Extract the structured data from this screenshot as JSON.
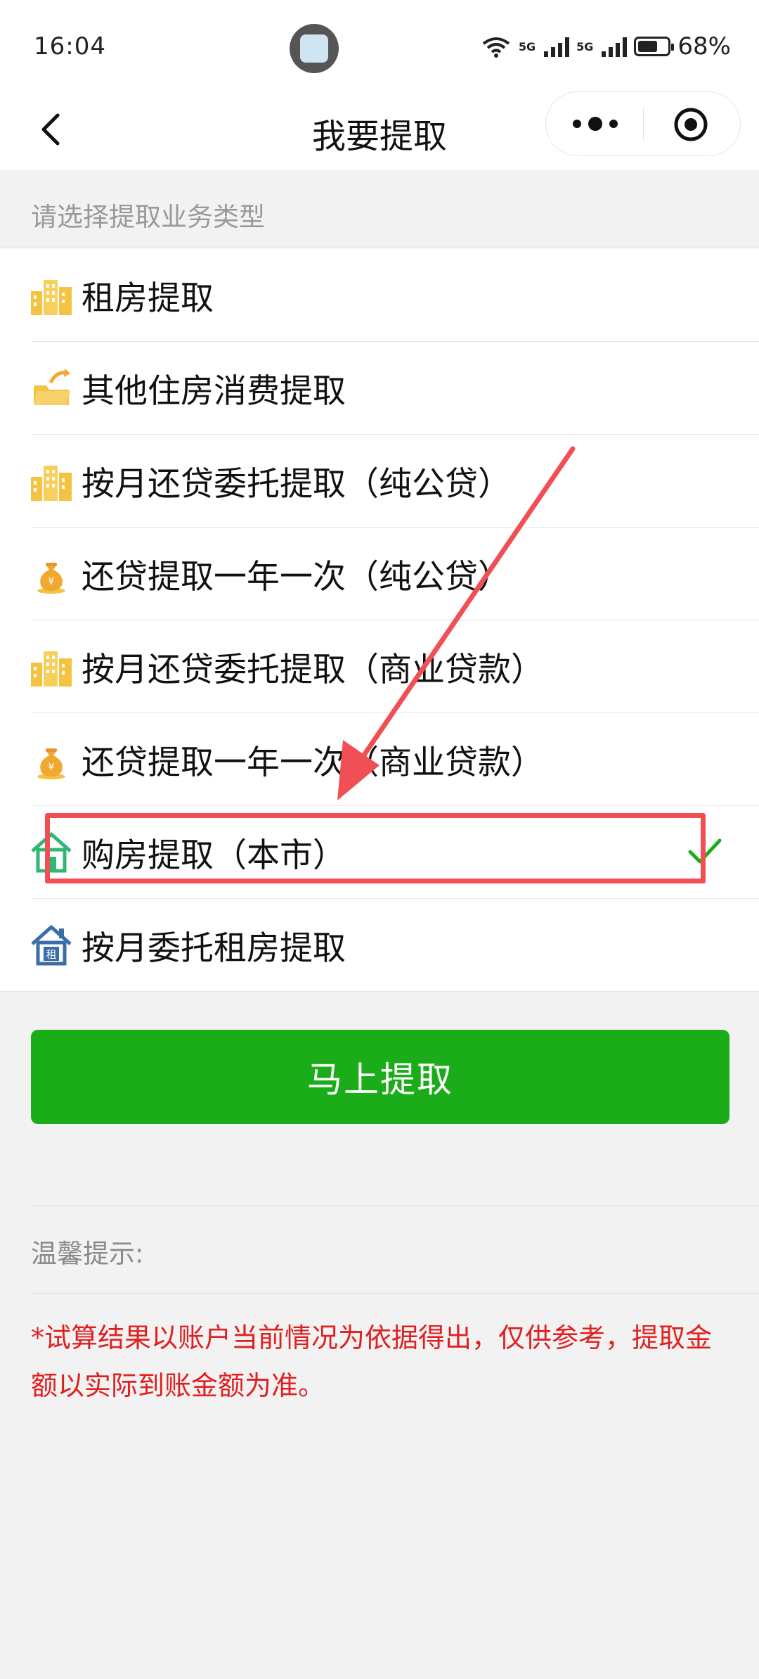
{
  "status_bar": {
    "time": "16:04",
    "network_1": "5G",
    "network_2": "5G",
    "battery_percent": "68%",
    "battery_level": 0.68
  },
  "nav": {
    "title": "我要提取"
  },
  "section_label": "请选择提取业务类型",
  "items": [
    {
      "label": "租房提取",
      "icon": "buildings-icon",
      "selected": false
    },
    {
      "label": "其他住房消费提取",
      "icon": "folder-arrow-icon",
      "selected": false
    },
    {
      "label": "按月还贷委托提取（纯公贷）",
      "icon": "buildings-icon",
      "selected": false
    },
    {
      "label": "还贷提取一年一次（纯公贷）",
      "icon": "money-bag-icon",
      "selected": false
    },
    {
      "label": "按月还贷委托提取（商业贷款）",
      "icon": "buildings-icon",
      "selected": false
    },
    {
      "label": "还贷提取一年一次（商业贷款）",
      "icon": "money-bag-icon",
      "selected": false
    },
    {
      "label": "购房提取（本市）",
      "icon": "house-green-icon",
      "selected": true
    },
    {
      "label": "按月委托租房提取",
      "icon": "house-rent-icon",
      "selected": false
    }
  ],
  "primary_button": "马上提取",
  "tips": {
    "label": "温馨提示:",
    "text": "*试算结果以账户当前情况为依据得出，仅供参考，提取金额以实际到账金额为准。"
  },
  "colors": {
    "primary_green": "#1aad19",
    "warning_red": "#e02020",
    "annotation_red": "#f05055",
    "building_yellow": "#f5c242"
  }
}
